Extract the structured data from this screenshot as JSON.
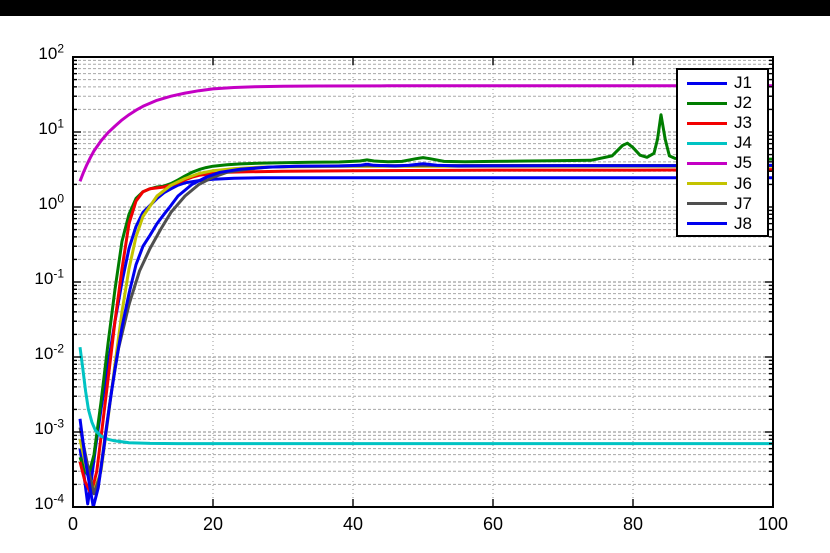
{
  "colors": {
    "background": "#ffffff",
    "top_bar": "#000000",
    "axis_box": "#000000",
    "grid_major": "#8a8a8a",
    "grid_minor": "#a8a8a8",
    "grid_vertical": "#999999"
  },
  "chart_data": {
    "type": "line",
    "title": "",
    "xlabel": "",
    "ylabel": "",
    "grid": true,
    "legend_position": "northeast",
    "x_axis": {
      "min": 0,
      "max": 100,
      "ticks": [
        0,
        20,
        40,
        60,
        80,
        100
      ],
      "labels": [
        "0",
        "20",
        "40",
        "60",
        "80",
        "100"
      ]
    },
    "y_axis": {
      "scale": "log",
      "min": 0.0001,
      "max": 100,
      "tick_exponents": [
        2,
        1,
        0,
        -1,
        -2,
        -3,
        -4
      ],
      "labels": [
        {
          "base": "10",
          "exp": "2"
        },
        {
          "base": "10",
          "exp": "1"
        },
        {
          "base": "10",
          "exp": "0"
        },
        {
          "base": "10",
          "exp": "-1"
        },
        {
          "base": "10",
          "exp": "-2"
        },
        {
          "base": "10",
          "exp": "-3"
        },
        {
          "base": "10",
          "exp": "-4"
        }
      ]
    },
    "series": [
      {
        "name": "J1",
        "color": "#0000ee",
        "points": [
          [
            1,
            0.0006
          ],
          [
            1.5,
            0.0003
          ],
          [
            2.1,
            0.00011
          ],
          [
            2.6,
            0.00022
          ],
          [
            3.2,
            0.0006
          ],
          [
            4,
            0.002
          ],
          [
            5,
            0.008
          ],
          [
            6,
            0.03
          ],
          [
            7,
            0.1
          ],
          [
            8,
            0.28
          ],
          [
            9,
            0.55
          ],
          [
            10,
            0.85
          ],
          [
            11,
            1.05
          ],
          [
            12,
            1.3
          ],
          [
            13,
            1.55
          ],
          [
            14,
            1.75
          ],
          [
            15,
            1.95
          ],
          [
            16,
            2.1
          ],
          [
            18,
            2.25
          ],
          [
            20,
            2.35
          ],
          [
            23,
            2.42
          ],
          [
            27,
            2.45
          ],
          [
            35,
            2.45
          ],
          [
            50,
            2.45
          ],
          [
            70,
            2.45
          ],
          [
            100,
            2.45
          ]
        ]
      },
      {
        "name": "J2",
        "color": "#007d00",
        "points": [
          [
            1,
            0.00046
          ],
          [
            1.6,
            0.00032
          ],
          [
            2.2,
            0.00026
          ],
          [
            3,
            0.0005
          ],
          [
            4,
            0.0025
          ],
          [
            5,
            0.015
          ],
          [
            6,
            0.08
          ],
          [
            7,
            0.35
          ],
          [
            8,
            0.8
          ],
          [
            9,
            1.3
          ],
          [
            10,
            1.6
          ],
          [
            11,
            1.75
          ],
          [
            12,
            1.85
          ],
          [
            13,
            1.9
          ],
          [
            14,
            2.05
          ],
          [
            15,
            2.3
          ],
          [
            16,
            2.6
          ],
          [
            17,
            2.9
          ],
          [
            18,
            3.15
          ],
          [
            19,
            3.35
          ],
          [
            20,
            3.5
          ],
          [
            22,
            3.65
          ],
          [
            24,
            3.75
          ],
          [
            27,
            3.85
          ],
          [
            30,
            3.9
          ],
          [
            34,
            3.95
          ],
          [
            38,
            3.98
          ],
          [
            41,
            4.1
          ],
          [
            42,
            4.25
          ],
          [
            43,
            4.1
          ],
          [
            45,
            4.0
          ],
          [
            47,
            4.05
          ],
          [
            49,
            4.4
          ],
          [
            50,
            4.55
          ],
          [
            51,
            4.4
          ],
          [
            53,
            4.05
          ],
          [
            56,
            4.0
          ],
          [
            60,
            4.05
          ],
          [
            65,
            4.1
          ],
          [
            70,
            4.15
          ],
          [
            74,
            4.2
          ],
          [
            77,
            4.8
          ],
          [
            78.5,
            6.6
          ],
          [
            79.2,
            7.1
          ],
          [
            80,
            6.2
          ],
          [
            81,
            4.9
          ],
          [
            82,
            4.6
          ],
          [
            83,
            5.2
          ],
          [
            83.5,
            8.0
          ],
          [
            84,
            17.0
          ],
          [
            84.6,
            8.0
          ],
          [
            85.2,
            4.8
          ],
          [
            86,
            4.45
          ],
          [
            90,
            4.3
          ],
          [
            95,
            4.3
          ],
          [
            100,
            4.35
          ]
        ]
      },
      {
        "name": "J3",
        "color": "#f20000",
        "points": [
          [
            1,
            0.0004
          ],
          [
            1.7,
            0.00022
          ],
          [
            2.6,
            0.00015
          ],
          [
            3.4,
            0.0003
          ],
          [
            4.2,
            0.0012
          ],
          [
            5,
            0.005
          ],
          [
            6,
            0.03
          ],
          [
            7,
            0.15
          ],
          [
            8,
            0.6
          ],
          [
            9,
            1.2
          ],
          [
            10,
            1.6
          ],
          [
            11,
            1.75
          ],
          [
            12,
            1.8
          ],
          [
            13,
            1.85
          ],
          [
            14,
            1.95
          ],
          [
            15,
            2.1
          ],
          [
            16,
            2.3
          ],
          [
            17,
            2.5
          ],
          [
            18,
            2.65
          ],
          [
            20,
            2.8
          ],
          [
            22,
            2.9
          ],
          [
            25,
            2.95
          ],
          [
            30,
            3.0
          ],
          [
            40,
            3.05
          ],
          [
            60,
            3.1
          ],
          [
            80,
            3.1
          ],
          [
            100,
            3.15
          ]
        ]
      },
      {
        "name": "J4",
        "color": "#00c3c3",
        "points": [
          [
            1,
            0.0135
          ],
          [
            1.4,
            0.007
          ],
          [
            1.8,
            0.0035
          ],
          [
            2.2,
            0.002
          ],
          [
            2.7,
            0.00135
          ],
          [
            3.2,
            0.00105
          ],
          [
            4,
            0.00088
          ],
          [
            5,
            0.0008
          ],
          [
            6,
            0.00076
          ],
          [
            8,
            0.00072
          ],
          [
            11,
            0.000705
          ],
          [
            15,
            0.0007
          ],
          [
            25,
            0.0007
          ],
          [
            50,
            0.0007
          ],
          [
            100,
            0.0007
          ]
        ]
      },
      {
        "name": "J5",
        "color": "#c400c4",
        "points": [
          [
            1,
            2.2
          ],
          [
            1.5,
            2.9
          ],
          [
            2,
            3.7
          ],
          [
            2.5,
            4.6
          ],
          [
            3,
            5.6
          ],
          [
            4,
            7.6
          ],
          [
            5,
            9.8
          ],
          [
            6,
            12
          ],
          [
            7,
            14.5
          ],
          [
            8,
            17
          ],
          [
            9,
            19.5
          ],
          [
            10,
            22
          ],
          [
            12,
            26.5
          ],
          [
            14,
            30
          ],
          [
            16,
            33
          ],
          [
            18,
            35.5
          ],
          [
            20,
            37.5
          ],
          [
            23,
            39.2
          ],
          [
            26,
            40.2
          ],
          [
            30,
            40.8
          ],
          [
            35,
            41.1
          ],
          [
            45,
            41.3
          ],
          [
            60,
            41.4
          ],
          [
            100,
            41.4
          ]
        ]
      },
      {
        "name": "J6",
        "color": "#c3c300",
        "points": [
          [
            1,
            0.0008
          ],
          [
            2,
            0.0003
          ],
          [
            3,
            0.00016
          ],
          [
            4,
            0.0003
          ],
          [
            5,
            0.0015
          ],
          [
            6,
            0.008
          ],
          [
            7,
            0.04
          ],
          [
            8,
            0.15
          ],
          [
            9,
            0.4
          ],
          [
            10,
            0.75
          ],
          [
            12,
            1.4
          ],
          [
            14,
            1.95
          ],
          [
            16,
            2.4
          ],
          [
            18,
            2.8
          ],
          [
            20,
            3.05
          ],
          [
            23,
            3.25
          ],
          [
            27,
            3.4
          ],
          [
            32,
            3.45
          ],
          [
            40,
            3.5
          ],
          [
            60,
            3.5
          ],
          [
            100,
            3.5
          ]
        ]
      },
      {
        "name": "J7",
        "color": "#4f4f4f",
        "points": [
          [
            1,
            0.00115
          ],
          [
            1.6,
            0.0006
          ],
          [
            2.2,
            0.00032
          ],
          [
            3,
            0.00015
          ],
          [
            3.8,
            0.00025
          ],
          [
            4.6,
            0.0009
          ],
          [
            5.5,
            0.0035
          ],
          [
            6.5,
            0.013
          ],
          [
            8,
            0.05
          ],
          [
            9.5,
            0.14
          ],
          [
            11,
            0.28
          ],
          [
            12.5,
            0.5
          ],
          [
            14,
            0.85
          ],
          [
            16,
            1.4
          ],
          [
            18,
            2.0
          ],
          [
            20,
            2.5
          ],
          [
            22,
            2.9
          ],
          [
            25,
            3.2
          ],
          [
            28,
            3.4
          ],
          [
            32,
            3.5
          ],
          [
            40,
            3.55
          ],
          [
            60,
            3.58
          ],
          [
            100,
            3.58
          ]
        ]
      },
      {
        "name": "J8",
        "color": "#0000ee",
        "points": [
          [
            1,
            0.0015
          ],
          [
            1.8,
            0.0004
          ],
          [
            2.9,
            0.0001
          ],
          [
            3.6,
            0.00018
          ],
          [
            4.4,
            0.0006
          ],
          [
            5.2,
            0.0022
          ],
          [
            6,
            0.007
          ],
          [
            7,
            0.025
          ],
          [
            8,
            0.07
          ],
          [
            9,
            0.17
          ],
          [
            10,
            0.3
          ],
          [
            11,
            0.42
          ],
          [
            12,
            0.6
          ],
          [
            13,
            0.8
          ],
          [
            14,
            1.05
          ],
          [
            15,
            1.4
          ],
          [
            17,
            2.0
          ],
          [
            19,
            2.5
          ],
          [
            21,
            2.9
          ],
          [
            24,
            3.2
          ],
          [
            28,
            3.4
          ],
          [
            32,
            3.5
          ],
          [
            38,
            3.52
          ],
          [
            41,
            3.6
          ],
          [
            42,
            3.72
          ],
          [
            43,
            3.6
          ],
          [
            46,
            3.52
          ],
          [
            48,
            3.6
          ],
          [
            50,
            3.78
          ],
          [
            52,
            3.6
          ],
          [
            55,
            3.52
          ],
          [
            60,
            3.53
          ],
          [
            70,
            3.55
          ],
          [
            80,
            3.55
          ],
          [
            90,
            3.55
          ],
          [
            100,
            3.6
          ]
        ]
      }
    ]
  },
  "legend": {
    "items": [
      "J1",
      "J2",
      "J3",
      "J4",
      "J5",
      "J6",
      "J7",
      "J8"
    ]
  }
}
